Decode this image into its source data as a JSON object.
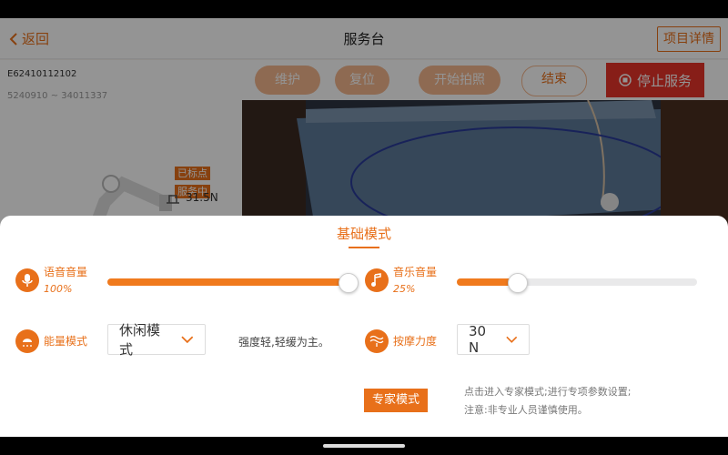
{
  "header": {
    "back_label": "返回",
    "title": "服务台",
    "details_label": "项目详情"
  },
  "left_panel": {
    "project_id": "E62410112102",
    "project_range": "5240910 ~ 34011337",
    "tag_marked": "已标点",
    "tag_in_service": "服务中",
    "force_value": "31.5N"
  },
  "actions": {
    "maintain": "维护",
    "reset": "复位",
    "start_photo": "开始拍照",
    "end": "结束",
    "stop_service": "停止服务"
  },
  "sheet": {
    "title": "基础模式",
    "voice_volume": {
      "label": "语音音量",
      "value_text": "100%",
      "value": 1.0
    },
    "music_volume": {
      "label": "音乐音量",
      "value_text": "25%",
      "value": 0.25
    },
    "energy_mode": {
      "label": "能量模式",
      "selected": "休闲模式",
      "description": "强度轻,轻缓为主。"
    },
    "massage_force": {
      "label": "按摩力度",
      "selected": "30 N"
    },
    "expert_button": "专家模式",
    "note_line1": "点击进入专家模式;进行专项参数设置;",
    "note_line2": "注意:非专业人员谨慎使用。"
  },
  "colors": {
    "accent": "#e8701a",
    "stop": "#e8342a",
    "pill_light": "#f5b78e"
  },
  "icons": [
    "chevron-left-icon",
    "stop-circle-icon",
    "robot-arm-icon",
    "microphone-icon",
    "music-note-icon",
    "energy-lamp-icon",
    "massage-wave-icon",
    "chevron-down-icon"
  ]
}
